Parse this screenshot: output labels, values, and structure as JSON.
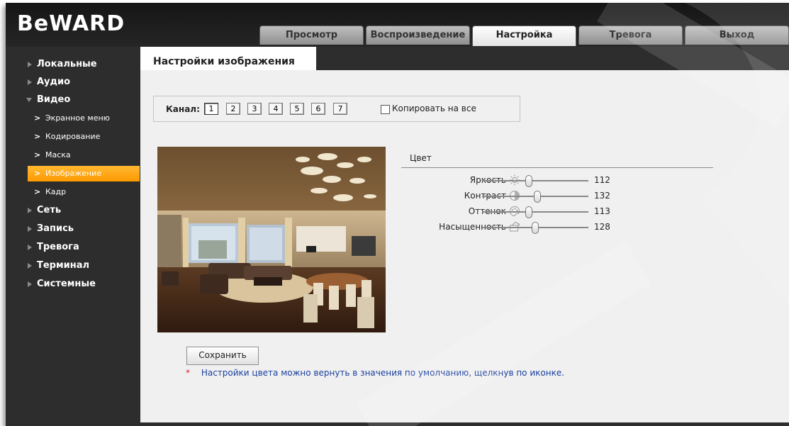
{
  "brand": {
    "logo_text": "BeWARD"
  },
  "tabs": [
    {
      "label": "Просмотр",
      "active": false
    },
    {
      "label": "Воспроизведение",
      "active": false
    },
    {
      "label": "Настройка",
      "active": true
    },
    {
      "label": "Тревога",
      "active": false
    },
    {
      "label": "Выход",
      "active": false
    }
  ],
  "sidebar": {
    "items": [
      {
        "label": "Локальные",
        "level": 0
      },
      {
        "label": "Аудио",
        "level": 0
      },
      {
        "label": "Видео",
        "level": 0,
        "expanded": true
      },
      {
        "label": "Экранное меню",
        "level": 1
      },
      {
        "label": "Кодирование",
        "level": 1
      },
      {
        "label": "Маска",
        "level": 1
      },
      {
        "label": "Изображение",
        "level": 1,
        "selected": true
      },
      {
        "label": "Кадр",
        "level": 1
      },
      {
        "label": "Сеть",
        "level": 0
      },
      {
        "label": "Запись",
        "level": 0
      },
      {
        "label": "Тревога",
        "level": 0
      },
      {
        "label": "Терминал",
        "level": 0
      },
      {
        "label": "Системные",
        "level": 0
      }
    ],
    "sub_marker": ">"
  },
  "page": {
    "title": "Настройки изображения"
  },
  "channel": {
    "label": "Канал:",
    "buttons": [
      "1",
      "2",
      "3",
      "4",
      "5",
      "6",
      "7"
    ],
    "selected": "1",
    "copy_all_label": "Копировать на все",
    "copy_all_checked": false
  },
  "color": {
    "title": "Цвет",
    "params": [
      {
        "label": "Яркость",
        "icon": "brightness-icon",
        "value": "112",
        "level": 0.44
      },
      {
        "label": "Контраст",
        "icon": "contrast-icon",
        "value": "132",
        "level": 0.52
      },
      {
        "label": "Оттенок",
        "icon": "hue-icon",
        "value": "113",
        "level": 0.44
      },
      {
        "label": "Насыщенность",
        "icon": "saturation-icon",
        "value": "128",
        "level": 0.5
      }
    ]
  },
  "save_label": "Сохранить",
  "note": {
    "star": "*",
    "text": "Настройки цвета можно вернуть в значения по умолчанию, щелкнув по иконке."
  },
  "colors": {
    "accent": "#ff9e00",
    "sidebar_bg": "#2d2d2d",
    "content_bg": "#f0f0f0",
    "note_text": "#1a3fa0"
  }
}
